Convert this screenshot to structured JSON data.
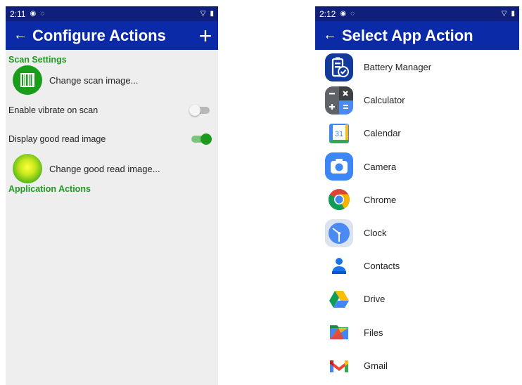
{
  "left": {
    "status": {
      "time": "2:11"
    },
    "title": "Configure Actions",
    "scan_settings_header": "Scan Settings",
    "change_scan_image": "Change scan image...",
    "enable_vibrate": "Enable vibrate on scan",
    "enable_vibrate_on": false,
    "display_good_read": "Display good read image",
    "display_good_read_on": true,
    "change_good_read": "Change good read image...",
    "application_actions_header": "Application Actions"
  },
  "right": {
    "status": {
      "time": "2:12"
    },
    "title": "Select App Action",
    "apps": [
      {
        "label": "Battery Manager",
        "icon": "battery-manager-icon"
      },
      {
        "label": "Calculator",
        "icon": "calculator-icon"
      },
      {
        "label": "Calendar",
        "icon": "calendar-icon",
        "calendar_number": "31"
      },
      {
        "label": "Camera",
        "icon": "camera-icon"
      },
      {
        "label": "Chrome",
        "icon": "chrome-icon"
      },
      {
        "label": "Clock",
        "icon": "clock-icon"
      },
      {
        "label": "Contacts",
        "icon": "contacts-icon"
      },
      {
        "label": "Drive",
        "icon": "drive-icon"
      },
      {
        "label": "Files",
        "icon": "files-icon"
      },
      {
        "label": "Gmail",
        "icon": "gmail-icon"
      }
    ]
  },
  "colors": {
    "appbar": "#0a2aa8",
    "statusbar": "#0f1f7a",
    "section_green": "#1f9a1f",
    "switch_on": "#1d9a1d"
  }
}
